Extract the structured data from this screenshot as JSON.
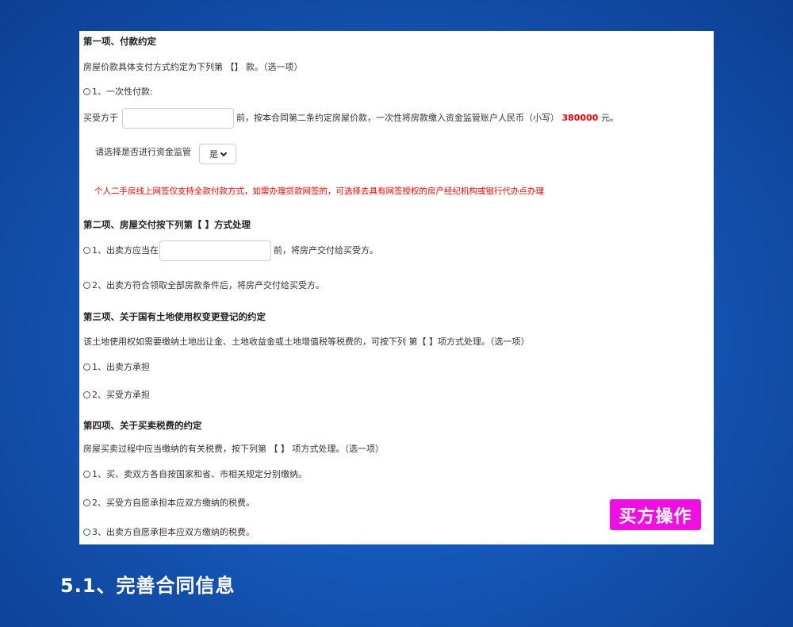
{
  "section1": {
    "heading": "第一项、付款约定",
    "intro": "房屋价款具体支付方式约定为下列第 【】 款。（选一项）",
    "option1_label": "1、一次性付款:",
    "payee_prefix": "买受方于",
    "payee_input_value": "",
    "payee_suffix": "前，按本合同第二条约定房屋价款，一次性将房款缴入资金监管账户人民币（小写）",
    "amount": "380000",
    "currency_unit": "元。",
    "supervision_label": "请选择是否进行资金监管",
    "supervision_selected": "是",
    "warning": "个人二手房线上网签仅支持全款付款方式，如需办理贷款网签的，可选择去具有网签授权的房产经纪机构或银行代办点办理"
  },
  "section2": {
    "heading": "第二项、房屋交付按下列第【 】方式处理",
    "option1_prefix": "1、出卖方应当在",
    "option1_input_value": "",
    "option1_suffix": "前，将房产交付给买受方。",
    "option2": "2、出卖方符合领取全部房款条件后，将房产交付给买受方。"
  },
  "section3": {
    "heading": "第三项、关于国有土地使用权变更登记的约定",
    "intro": "该土地使用权如需要缴纳土地出让金、土地收益金或土地增值税等税费的，可按下列 第【 】项方式处理。（选一项）",
    "option1": "1、出卖方承担",
    "option2": "2、买受方承担"
  },
  "section4": {
    "heading": "第四项、关于买卖税费的约定",
    "intro": "房屋买卖过程中应当缴纳的有关税费，按下列第 【 】 项方式处理。（选一项）",
    "option1": "1、买、卖双方各自按国家和省、市相关规定分别缴纳。",
    "option2": "2、买受方自愿承担本应双方缴纳的税费。",
    "option3": "3、出卖方自愿承担本应双方缴纳的税费。"
  },
  "badge": "买方操作",
  "footer_title": "5.1、完善合同信息",
  "colors": {
    "background": "#1557b8",
    "badge": "#ef0fe2",
    "warning": "#ff0000",
    "amount": "#ff0000"
  }
}
